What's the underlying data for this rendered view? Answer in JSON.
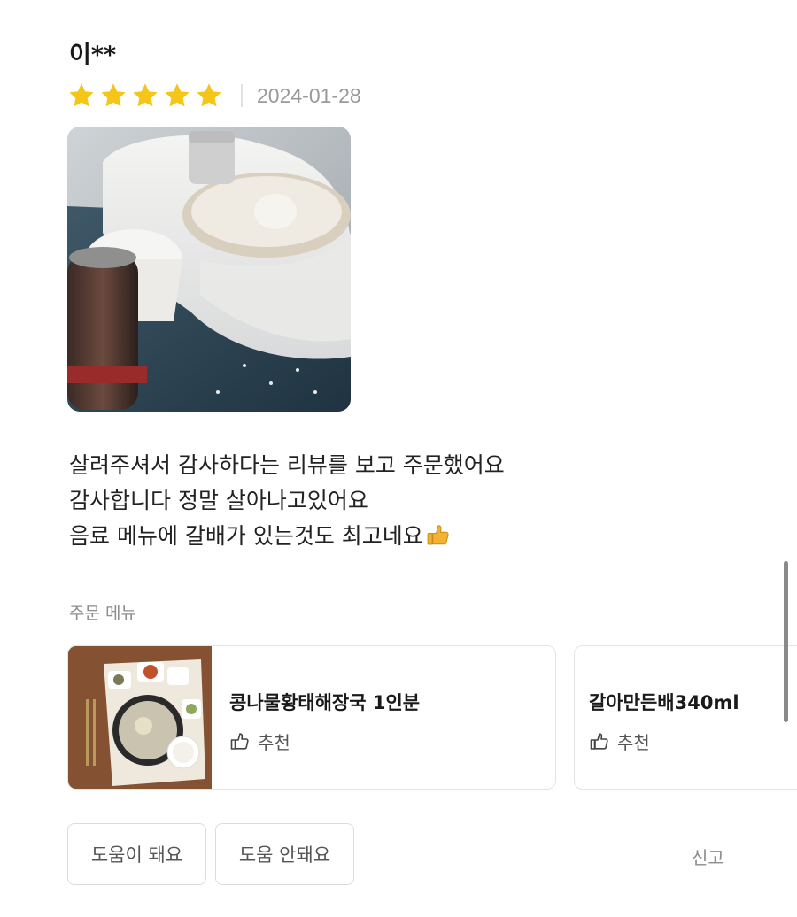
{
  "review": {
    "reviewer_name": "이**",
    "rating": 5,
    "rating_max": 5,
    "date": "2024-01-28",
    "photo_icon": "review-photo",
    "text_lines": [
      "살려주셔서 감사하다는 리뷰를 보고 주문했어요",
      "감사합니다 정말 살아나고있어요",
      "음료 메뉴에 갈배가 있는것도 최고네요"
    ],
    "text_emoji_icon": "thumbs-up-emoji"
  },
  "order_menu": {
    "label": "주문 메뉴",
    "items": [
      {
        "name": "콩나물황태해장국 1인분",
        "recommend_label": "추천",
        "thumbnail_icon": "soup-set-photo"
      },
      {
        "name": "갈아만든배340ml",
        "recommend_label": "추천"
      }
    ]
  },
  "actions": {
    "helpful_label": "도움이 돼요",
    "not_helpful_label": "도움 안돼요",
    "report_label": "신고"
  },
  "colors": {
    "star": "#f5c518",
    "text_primary": "#1a1a1a",
    "text_muted": "#8c8c8c",
    "border": "#e4e4e4"
  }
}
